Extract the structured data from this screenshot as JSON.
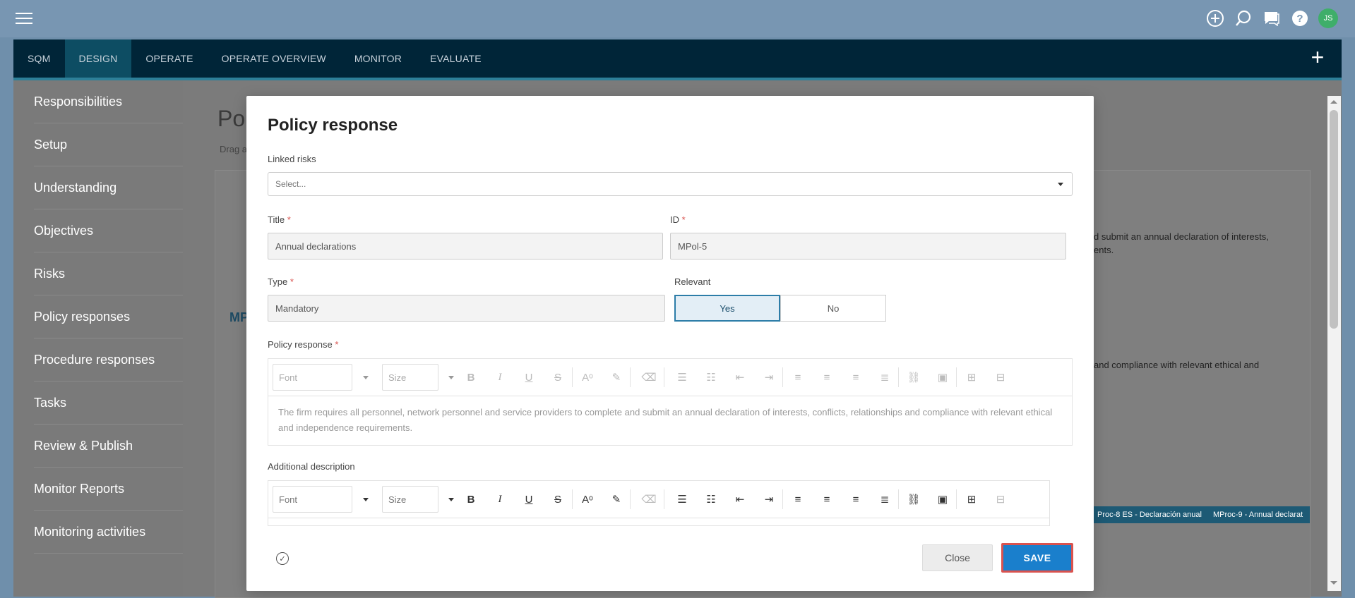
{
  "topbar": {
    "avatar_initials": "JS",
    "icons": [
      "plus-circle-icon",
      "search-icon",
      "chat-icon",
      "help-icon"
    ]
  },
  "nav": {
    "tabs": [
      {
        "label": "SQM",
        "active": false
      },
      {
        "label": "DESIGN",
        "active": true
      },
      {
        "label": "OPERATE",
        "active": false
      },
      {
        "label": "OPERATE OVERVIEW",
        "active": false
      },
      {
        "label": "MONITOR",
        "active": false
      },
      {
        "label": "EVALUATE",
        "active": false
      }
    ]
  },
  "sidebar": {
    "items": [
      {
        "label": "Responsibilities"
      },
      {
        "label": "Setup"
      },
      {
        "label": "Understanding"
      },
      {
        "label": "Objectives"
      },
      {
        "label": "Risks"
      },
      {
        "label": "Policy responses"
      },
      {
        "label": "Procedure responses"
      },
      {
        "label": "Tasks"
      },
      {
        "label": "Review & Publish"
      },
      {
        "label": "Monitor Reports"
      },
      {
        "label": "Monitoring activities"
      }
    ]
  },
  "background": {
    "title_fragment": "Pol",
    "subtitle_fragment": "Drag a",
    "text_1": "d submit an annual declaration of interests,",
    "text_2": "ents.",
    "text_3": "and compliance with relevant ethical and",
    "row_code": "MP",
    "chips": [
      "Proc-8 ES - Declaración anual",
      "MProc-9 - Annual declarat"
    ]
  },
  "modal": {
    "title": "Policy response",
    "linked_risks": {
      "label": "Linked risks",
      "placeholder": "Select..."
    },
    "title_field": {
      "label": "Title",
      "required": "*",
      "value": "Annual declarations"
    },
    "id_field": {
      "label": "ID",
      "required": "*",
      "value": "MPol-5"
    },
    "type_field": {
      "label": "Type",
      "required": "*",
      "value": "Mandatory"
    },
    "relevant": {
      "label": "Relevant",
      "yes": "Yes",
      "no": "No",
      "selected": "Yes"
    },
    "policy_response": {
      "label": "Policy response",
      "required": "*",
      "font_placeholder": "Font",
      "size_placeholder": "Size",
      "text": "The firm requires all personnel, network personnel and service providers to complete and submit an annual declaration of interests, conflicts, relationships and compliance with relevant ethical and independence requirements."
    },
    "additional_description": {
      "label": "Additional description",
      "font_placeholder": "Font",
      "size_placeholder": "Size"
    },
    "footer": {
      "close_label": "Close",
      "save_label": "SAVE"
    }
  }
}
